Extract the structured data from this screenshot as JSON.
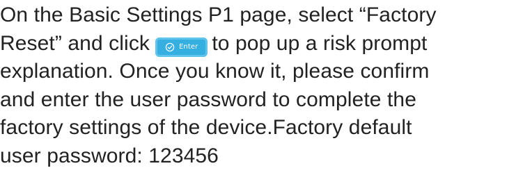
{
  "instructions": {
    "line1": "On the Basic Settings P1 page, select “Factory",
    "line2_before": "Reset” and click",
    "line2_after": "to pop up a risk prompt",
    "line3": "explanation. Once you know it, please confirm",
    "line4": "and enter the user password to complete the",
    "line5": "factory settings of the device.Factory default",
    "line6": "user password: 123456"
  },
  "enter_button": {
    "label": "Enter",
    "icon": "check-circle-icon",
    "color": "#35aee0"
  }
}
